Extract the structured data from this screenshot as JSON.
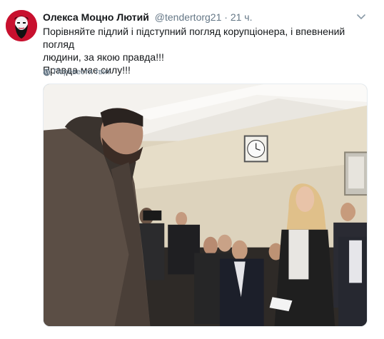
{
  "tweet": {
    "author_name": "Олекса Моцно Лютий",
    "handle": "@tendertorg21",
    "separator": "·",
    "time": "21 ч.",
    "text_line1": "Порівняйте підлий і підступний погляд корупціонера, і впевнений погляд",
    "text_line2": "людини, за якою правда!!!",
    "text_line3": "Правда має силу!!!",
    "translate_label": "Перевести твит"
  },
  "colors": {
    "avatar_bg": "#c8102e",
    "secondary_text": "#657786",
    "primary_text": "#14171a"
  },
  "icons": {
    "caret": "chevron-down-icon",
    "translate": "globe-icon"
  }
}
